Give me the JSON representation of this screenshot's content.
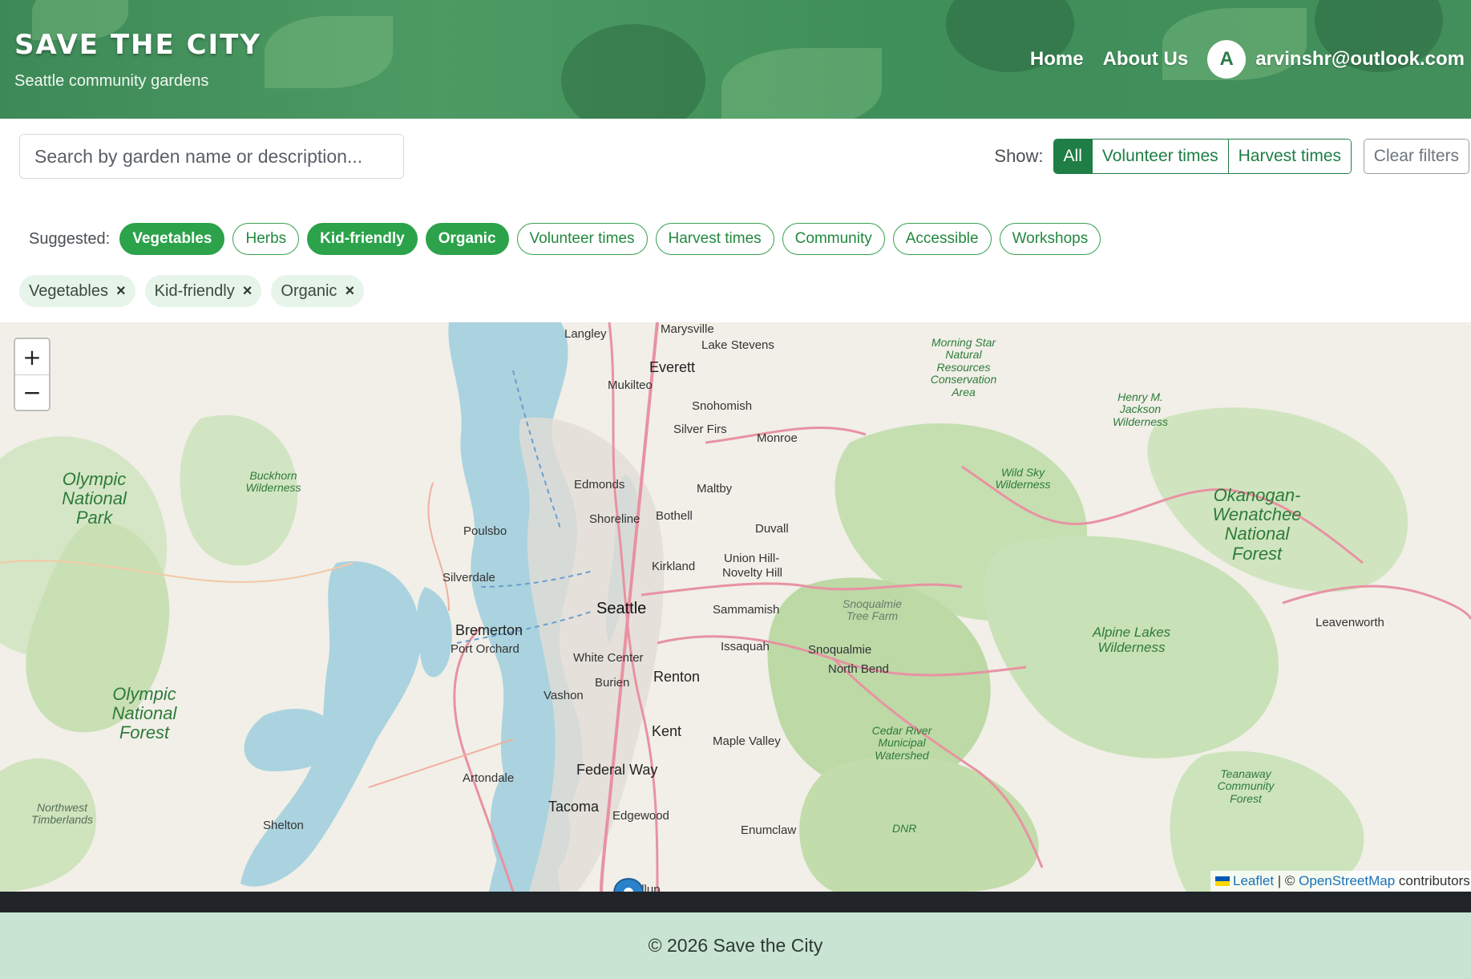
{
  "header": {
    "title": "Save the City",
    "subtitle": "Seattle community gardens",
    "nav": [
      {
        "label": "Home"
      },
      {
        "label": "About Us"
      }
    ],
    "user": {
      "initial": "A",
      "email": "arvinshr@outlook.com"
    }
  },
  "toolbar": {
    "search_placeholder": "Search by garden name or description...",
    "show_label": "Show:",
    "show_options": [
      {
        "label": "All",
        "active": true
      },
      {
        "label": "Volunteer times",
        "active": false
      },
      {
        "label": "Harvest times",
        "active": false
      }
    ],
    "clear_label": "Clear filters"
  },
  "suggested": {
    "label": "Suggested:",
    "chips": [
      {
        "label": "Vegetables",
        "on": true
      },
      {
        "label": "Herbs",
        "on": false
      },
      {
        "label": "Kid-friendly",
        "on": true
      },
      {
        "label": "Organic",
        "on": true
      },
      {
        "label": "Volunteer times",
        "on": false
      },
      {
        "label": "Harvest times",
        "on": false
      },
      {
        "label": "Community",
        "on": false
      },
      {
        "label": "Accessible",
        "on": false
      },
      {
        "label": "Workshops",
        "on": false
      }
    ]
  },
  "active_filters": [
    {
      "label": "Vegetables",
      "remove": "×"
    },
    {
      "label": "Kid-friendly",
      "remove": "×"
    },
    {
      "label": "Organic",
      "remove": "×"
    }
  ],
  "map": {
    "zoom_in": "+",
    "zoom_out": "−",
    "attribution": {
      "leaflet": "Leaflet",
      "sep": " | © ",
      "osm": "OpenStreetMap",
      "rest": " contributors"
    },
    "labels": {
      "marysville": "Marysville",
      "langley": "Langley",
      "lake_stevens": "Lake Stevens",
      "everett": "Everett",
      "mukilteo": "Mukilteo",
      "snohomish": "Snohomish",
      "silver_firs": "Silver Firs",
      "monroe": "Monroe",
      "edmonds": "Edmonds",
      "maltby": "Maltby",
      "shoreline": "Shoreline",
      "bothell": "Bothell",
      "duvall": "Duvall",
      "poulsbo": "Poulsbo",
      "kirkland": "Kirkland",
      "union_hill": "Union Hill-",
      "novelty_hill": "Novelty Hill",
      "silverdale": "Silverdale",
      "seattle": "Seattle",
      "sammamish": "Sammamish",
      "bremerton": "Bremerton",
      "port_orchard": "Port Orchard",
      "issaquah": "Issaquah",
      "snoqualmie": "Snoqualmie",
      "white_center": "White Center",
      "north_bend": "North Bend",
      "burien": "Burien",
      "renton": "Renton",
      "vashon": "Vashon",
      "kent": "Kent",
      "maple_valley": "Maple Valley",
      "federal_way": "Federal Way",
      "artondale": "Artondale",
      "tacoma": "Tacoma",
      "edgewood": "Edgewood",
      "shelton": "Shelton",
      "puyallup": "Puyallup",
      "enumclaw": "Enumclaw",
      "dnr": "DNR",
      "leavenworth": "Leavenworth",
      "olympic_park": "Olympic National Park",
      "olympic_forest": "Olympic National Forest",
      "buckhorn": "Buckhorn Wilderness",
      "northwest_timberlands": "Northwest Timberlands",
      "morning_star": "Morning Star Natural Resources Conservation Area",
      "henry_jackson": "Henry M. Jackson Wilderness",
      "wild_sky": "Wild Sky Wilderness",
      "okanogan": "Okanogan-Wenatchee National Forest",
      "snoqualmie_tree": "Snoqualmie Tree Farm",
      "alpine_lakes": "Alpine Lakes Wilderness",
      "cedar_river": "Cedar River Municipal Watershed",
      "teanaway": "Teanaway Community Forest"
    }
  },
  "footer": {
    "text": "© 2026 Save the City"
  }
}
